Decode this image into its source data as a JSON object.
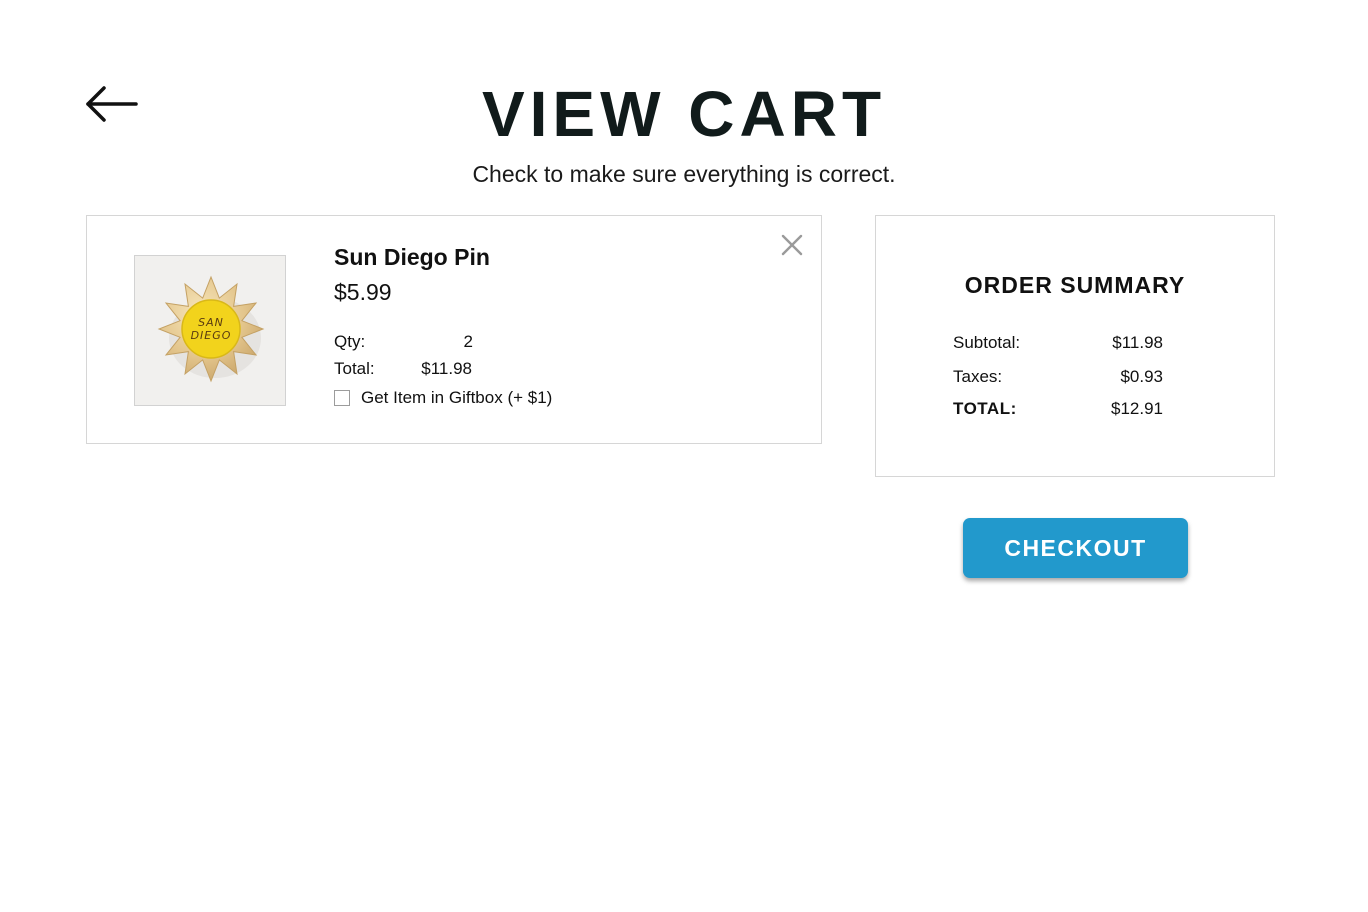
{
  "header": {
    "back_icon": "arrow-left-icon",
    "title": "VIEW CART",
    "subtitle": "Check to make sure everything is correct."
  },
  "cart": {
    "items": [
      {
        "name": "Sun Diego Pin",
        "price": "$5.99",
        "qty_label": "Qty:",
        "qty": "2",
        "total_label": "Total:",
        "total": "$11.98",
        "giftbox_label": "Get Item in Giftbox (+ $1)",
        "giftbox_checked": false,
        "image_text": [
          "SAN",
          "DIEGO"
        ],
        "remove_icon": "close-icon"
      }
    ]
  },
  "summary": {
    "title": "ORDER SUMMARY",
    "subtotal_label": "Subtotal:",
    "subtotal": "$11.98",
    "taxes_label": "Taxes:",
    "taxes": "$0.93",
    "total_label": "TOTAL:",
    "total": "$12.91"
  },
  "checkout": {
    "label": "CHECKOUT"
  },
  "colors": {
    "accent": "#2299cc",
    "border": "#d6d6d6",
    "pin_yellow": "#f2d31c",
    "pin_gold": "#e8d2a0"
  }
}
